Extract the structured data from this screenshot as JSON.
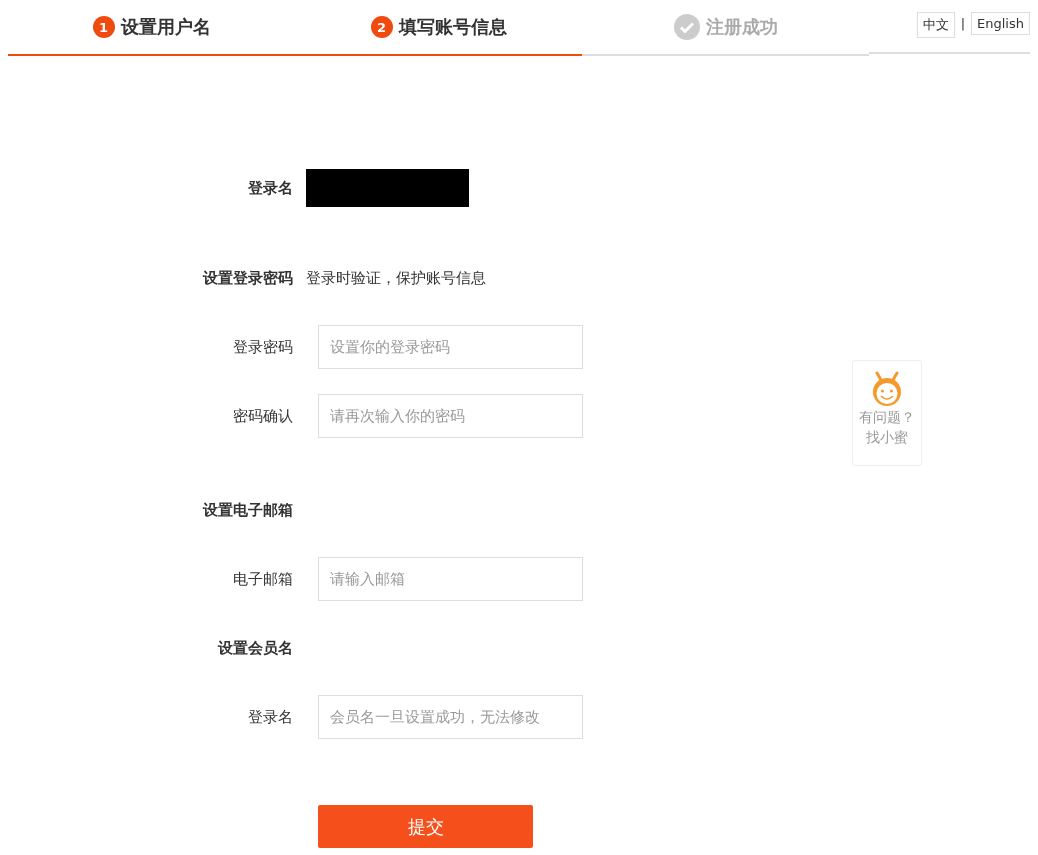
{
  "steps": [
    {
      "number": "1",
      "label": "设置用户名",
      "kind": "numbered",
      "active": true
    },
    {
      "number": "2",
      "label": "填写账号信息",
      "kind": "numbered",
      "active": true
    },
    {
      "label": "注册成功",
      "kind": "check",
      "active": false
    }
  ],
  "languages": [
    "中文",
    "English"
  ],
  "language_separator": "|",
  "form": [
    {
      "kind": "redacted",
      "label": "登录名"
    },
    {
      "kind": "section",
      "label": "设置登录密码",
      "note": "登录时验证，保护账号信息"
    },
    {
      "kind": "field",
      "label": "登录密码",
      "placeholder": "设置你的登录密码"
    },
    {
      "kind": "field",
      "label": "密码确认",
      "placeholder": "请再次输入你的密码"
    },
    {
      "kind": "section",
      "label": "设置电子邮箱"
    },
    {
      "kind": "field",
      "label": "电子邮箱",
      "placeholder": "请输入邮箱"
    },
    {
      "kind": "section",
      "label": "设置会员名"
    },
    {
      "kind": "field",
      "label": "登录名",
      "placeholder": "会员名一旦设置成功，无法修改"
    }
  ],
  "submit": "提交",
  "help": {
    "line_1": "有问题？",
    "line_2": "找小蜜"
  }
}
